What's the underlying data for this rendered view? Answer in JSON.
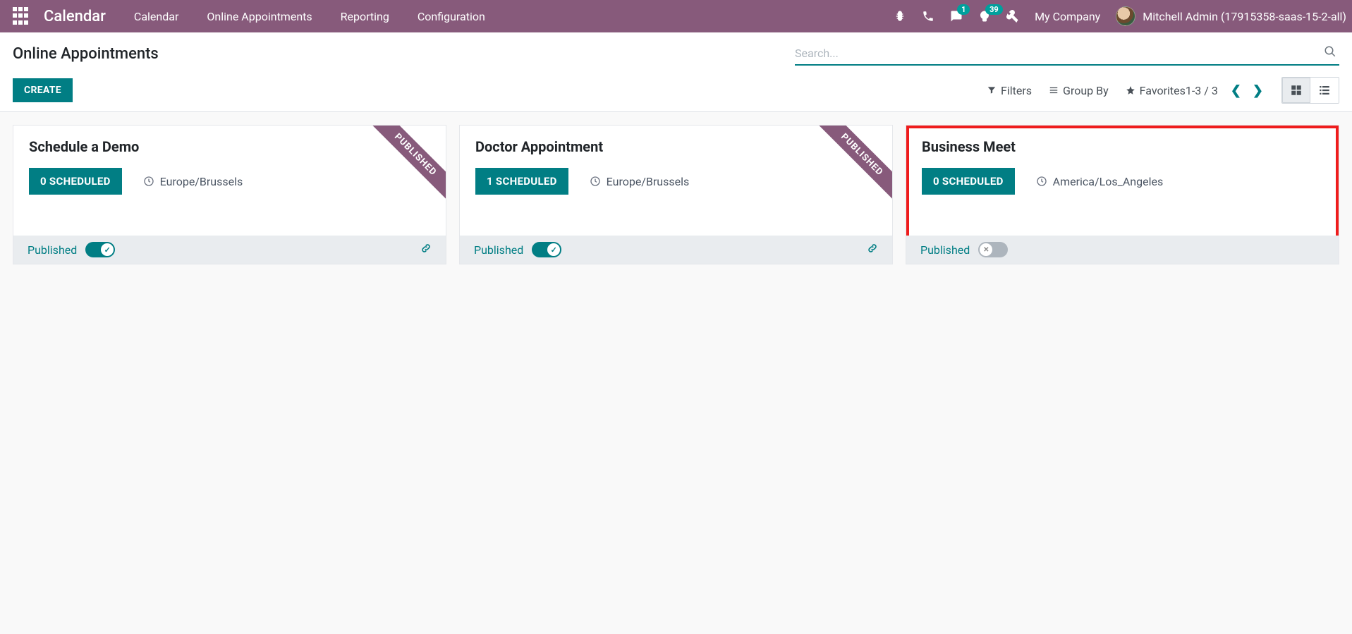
{
  "nav": {
    "brand": "Calendar",
    "menu": [
      "Calendar",
      "Online Appointments",
      "Reporting",
      "Configuration"
    ],
    "badge_messages": "1",
    "badge_activities": "39",
    "company": "My Company",
    "user": "Mitchell Admin (17915358-saas-15-2-all)"
  },
  "control": {
    "title": "Online Appointments",
    "create": "CREATE",
    "search_placeholder": "Search...",
    "filters": "Filters",
    "groupby": "Group By",
    "favorites": "Favorites",
    "pager": "1-3 / 3"
  },
  "ribbon": "PUBLISHED",
  "published_label": "Published",
  "cards": [
    {
      "title": "Schedule a Demo",
      "scheduled": "0 SCHEDULED",
      "tz": "Europe/Brussels",
      "published": true,
      "has_link": true,
      "highlighted": false
    },
    {
      "title": "Doctor Appointment",
      "scheduled": "1 SCHEDULED",
      "tz": "Europe/Brussels",
      "published": true,
      "has_link": true,
      "highlighted": false
    },
    {
      "title": "Business Meet",
      "scheduled": "0 SCHEDULED",
      "tz": "America/Los_Angeles",
      "published": false,
      "has_link": false,
      "highlighted": true
    }
  ]
}
